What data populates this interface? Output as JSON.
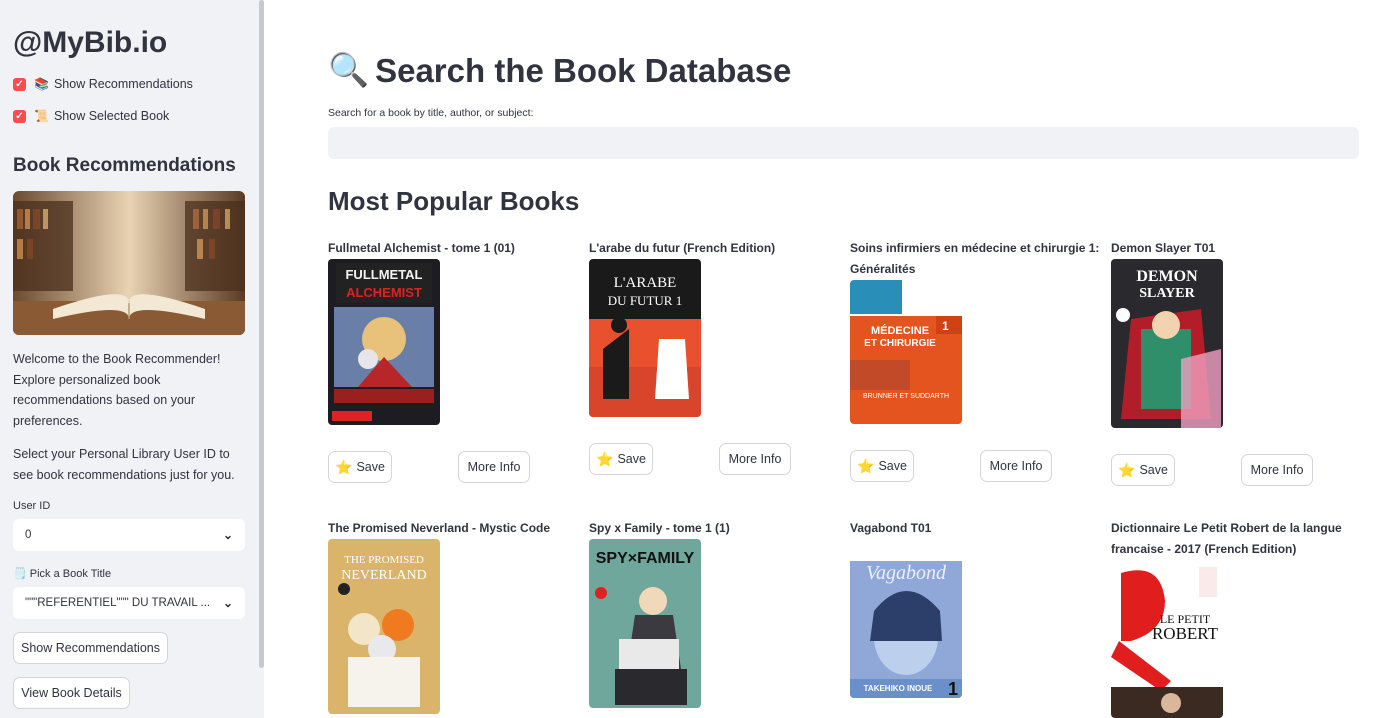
{
  "sidebar": {
    "brand": "@MyBib.io",
    "checkboxes": [
      {
        "emoji": "📚",
        "label": "Show Recommendations",
        "checked": true
      },
      {
        "emoji": "📜",
        "label": "Show Selected Book",
        "checked": true
      }
    ],
    "heading": "Book Recommendations",
    "welcome": "Welcome to the Book Recommender! Explore personalized book recommendations based on your preferences.",
    "select_prompt": "Select your Personal Library User ID to see book recommendations just for you.",
    "user_id_label": "User ID",
    "user_id_value": "0",
    "book_title_label": "🗒️ Pick a Book Title",
    "book_title_value": "\"\"\"REFERENTIEL\"\"\" DU TRAVAIL ...",
    "show_recs_button": "Show Recommendations",
    "view_details_button": "View Book Details"
  },
  "main": {
    "title_icon": "🔍",
    "title": "Search the Book Database",
    "search_label": "Search for a book by title, author, or subject:",
    "search_value": "",
    "popular_heading": "Most Popular Books",
    "save_label": "Save",
    "save_icon": "⭐",
    "info_label": "More Info",
    "books": [
      {
        "title": "Fullmetal Alchemist - tome 1 (01)",
        "cover_text": "FULLMETAL ALCHEMIST"
      },
      {
        "title": "L'arabe du futur (French Edition)",
        "cover_text": "L'ARABE DU FUTUR 1"
      },
      {
        "title": "Soins infirmiers en médecine et chirurgie 1: Généralités",
        "cover_text": "MÉDECINE ET CHIRURGIE"
      },
      {
        "title": "Demon Slayer T01",
        "cover_text": "DEMON SLAYER"
      },
      {
        "title": "The Promised Neverland - Mystic Code",
        "cover_text": "THE PROMISED NEVERLAND"
      },
      {
        "title": "Spy x Family - tome 1 (1)",
        "cover_text": "SPY×FAMILY"
      },
      {
        "title": "Vagabond T01",
        "cover_text": "Vagabond"
      },
      {
        "title": "Dictionnaire Le Petit Robert de la langue francaise - 2017 (French Edition)",
        "cover_text": "LE PETIT ROBERT"
      }
    ]
  }
}
